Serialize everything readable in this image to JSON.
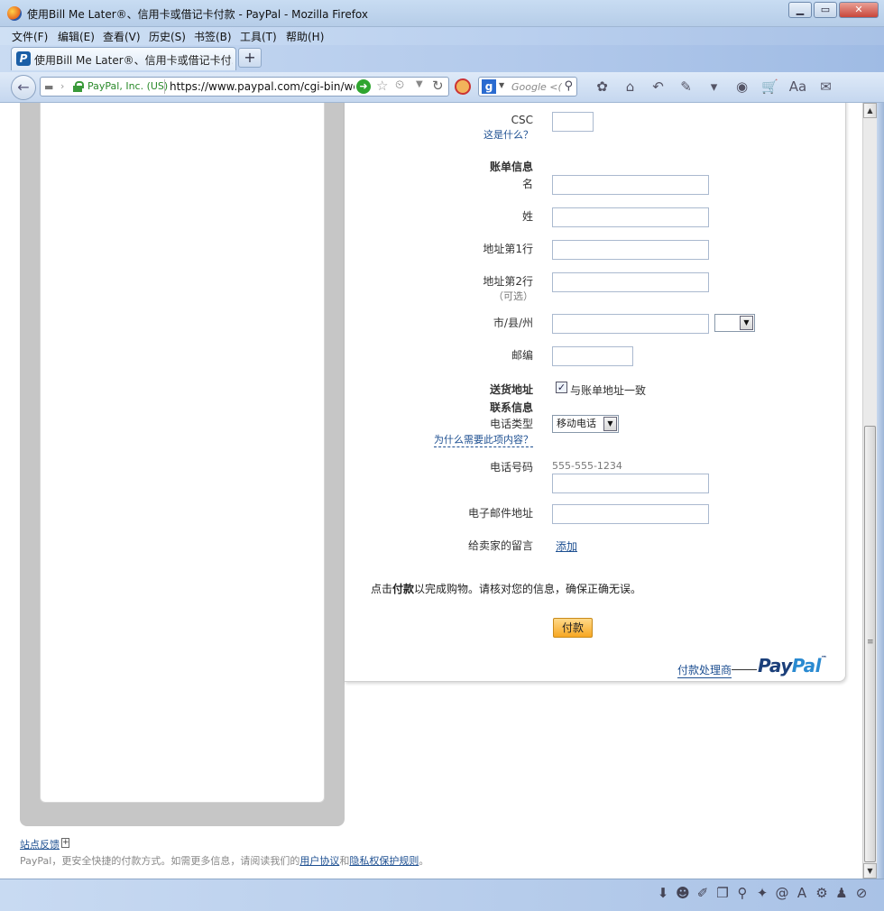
{
  "window": {
    "title": "使用Bill Me Later®、信用卡或借记卡付款 - PayPal - Mozilla Firefox",
    "controls": [
      "▁",
      "▭",
      "✕"
    ]
  },
  "menu": [
    "文件(F)",
    "编辑(E)",
    "查看(V)",
    "历史(S)",
    "书签(B)",
    "工具(T)",
    "帮助(H)"
  ],
  "tab": {
    "label": "使用Bill Me Later®、信用卡或借记卡付...",
    "new_tab": "+"
  },
  "navbar": {
    "back": "←",
    "site_identity": "PayPal, Inc. (US)",
    "url": "https://www.paypal.com/cgi-bin/web",
    "search_engine": "g",
    "search_placeholder": "Google <(",
    "toolbar_icons": [
      "bee-icon",
      "home-icon",
      "undo-icon",
      "pin-icon",
      "dropdown-icon",
      "media-icon",
      "cart-icon",
      "text-icon",
      "chat-icon"
    ]
  },
  "form": {
    "csc_label": "CSC",
    "csc_help": "这是什么？",
    "billing_header": "账单信息",
    "first_name_label": "名",
    "last_name_label": "姓",
    "address1_label": "地址第1行",
    "address2_label": "地址第2行",
    "address2_optional": "（可选）",
    "city_label": "市/县/州",
    "zip_label": "邮编",
    "shipping_label": "送货地址",
    "same_as_billing": "与账单地址一致",
    "same_as_billing_checked": true,
    "contact_header": "联系信息",
    "phone_type_label": "电话类型",
    "phone_type_value": "移动电话",
    "why_needed": "为什么需要此项内容？",
    "phone_number_label": "电话号码",
    "phone_placeholder": "555-555-1234",
    "email_label": "电子邮件地址",
    "seller_note_label": "给卖家的留言",
    "add_link": "添加",
    "pay_instruction_prefix": "点击",
    "pay_instruction_bold": "付款",
    "pay_instruction_suffix": "以完成购物。请核对您的信息，确保正确无误。",
    "pay_button": "付款",
    "processor_text": "付款处理商",
    "paypal_logo": "PayPal"
  },
  "footer": {
    "feedback": "站点反馈",
    "feedback_plus": "+",
    "text_prefix": "PayPal，更安全快捷的付款方式。如需更多信息，请阅读我们的",
    "user_agreement": "用户协议",
    "and": "和",
    "privacy": "隐私权保护规则",
    "end": "。"
  },
  "statusbar_icons": [
    "download-icon",
    "mask-icon",
    "brush-icon",
    "window-icon",
    "search-icon",
    "fox-icon",
    "at-icon",
    "font-icon",
    "gear-icon",
    "person-icon",
    "noscript-icon"
  ]
}
